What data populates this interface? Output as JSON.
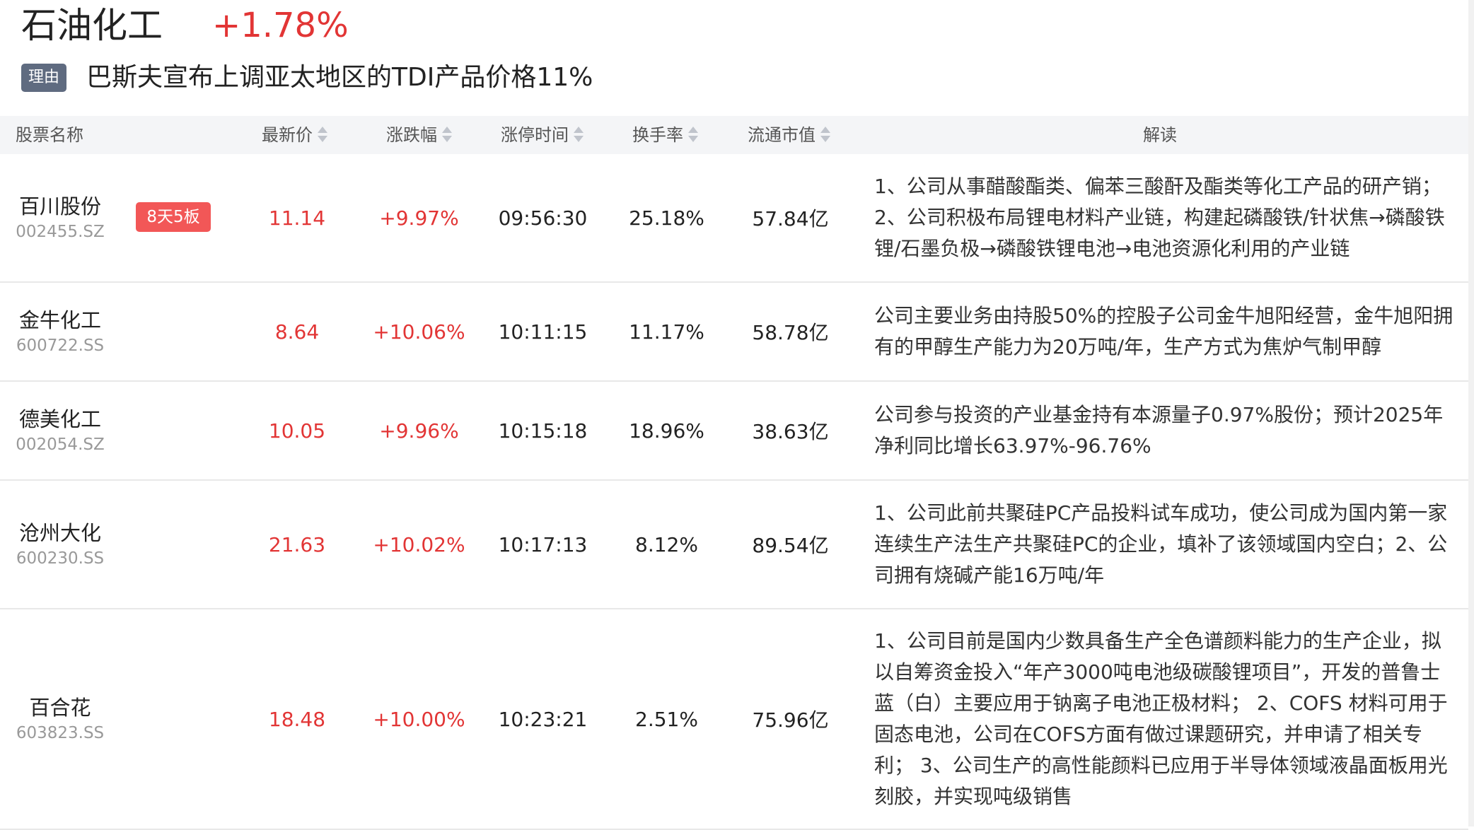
{
  "header": {
    "sector_name": "石油化工",
    "sector_change": "+1.78%",
    "reason_tag": "理由",
    "reason_text": "巴斯夫宣布上调亚太地区的TDI产品价格11%"
  },
  "table": {
    "columns": {
      "name": "股票名称",
      "price": "最新价",
      "change": "涨跌幅",
      "limit_time": "涨停时间",
      "turnover": "换手率",
      "market_cap": "流通市值",
      "analysis": "解读"
    },
    "rows": [
      {
        "name": "百川股份",
        "code": "002455.SZ",
        "badge": "8天5板",
        "price": "11.14",
        "change": "+9.97%",
        "limit_time": "09:56:30",
        "turnover": "25.18%",
        "market_cap": "57.84亿",
        "analysis": "1、公司从事醋酸酯类、偏苯三酸酐及酯类等化工产品的研产销；2、公司积极布局锂电材料产业链，构建起磷酸铁/针状焦→磷酸铁锂/石墨负极→磷酸铁锂电池→电池资源化利用的产业链"
      },
      {
        "name": "金牛化工",
        "code": "600722.SS",
        "badge": "",
        "price": "8.64",
        "change": "+10.06%",
        "limit_time": "10:11:15",
        "turnover": "11.17%",
        "market_cap": "58.78亿",
        "analysis": "公司主要业务由持股50%的控股子公司金牛旭阳经营，金牛旭阳拥有的甲醇生产能力为20万吨/年，生产方式为焦炉气制甲醇"
      },
      {
        "name": "德美化工",
        "code": "002054.SZ",
        "badge": "",
        "price": "10.05",
        "change": "+9.96%",
        "limit_time": "10:15:18",
        "turnover": "18.96%",
        "market_cap": "38.63亿",
        "analysis": "公司参与投资的产业基金持有本源量子0.97%股份；预计2025年净利同比增长63.97%-96.76%"
      },
      {
        "name": "沧州大化",
        "code": "600230.SS",
        "badge": "",
        "price": "21.63",
        "change": "+10.02%",
        "limit_time": "10:17:13",
        "turnover": "8.12%",
        "market_cap": "89.54亿",
        "analysis": "1、公司此前共聚硅PC产品投料试车成功，使公司成为国内第一家连续生产法生产共聚硅PC的企业，填补了该领域国内空白；2、公司拥有烧碱产能16万吨/年"
      },
      {
        "name": "百合花",
        "code": "603823.SS",
        "badge": "",
        "price": "18.48",
        "change": "+10.00%",
        "limit_time": "10:23:21",
        "turnover": "2.51%",
        "market_cap": "75.96亿",
        "analysis": "1、公司目前是国内少数具备生产全色谱颜料能力的生产企业，拟以自筹资金投入“年产3000吨电池级碳酸锂项目”，开发的普鲁士蓝（白）主要应用于钠离子电池正极材料； 2、COFS 材料可用于固态电池，公司在COFS方面有做过课题研究，并申请了相关专利； 3、公司生产的高性能颜料已应用于半导体领域液晶面板用光刻胶，并实现吨级销售"
      }
    ]
  },
  "colors": {
    "up_red": "#e23535",
    "badge_red": "#f25757",
    "tag_gray": "#5f6b80",
    "header_bg": "#f4f5f7"
  }
}
